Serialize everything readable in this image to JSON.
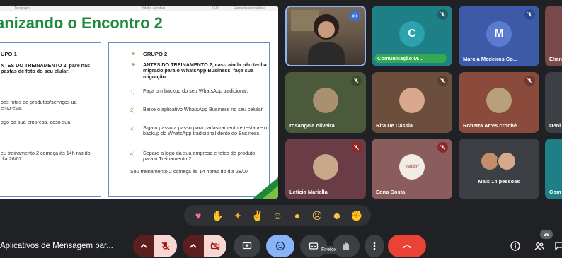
{
  "slide": {
    "top_strip": [
      "Telegraph",
      "Adobe Acrobat",
      "ISO",
      "Comunicacionalidad"
    ],
    "title": "anizando o Encontro 2",
    "group1": {
      "head": "UPO 1",
      "intro": "NTES DO TREINAMENTO 2, pare nas pastas de foto do seu elular:",
      "item1": "oas fotos de produtos/serviços ua empresa.",
      "item2": "ogo da sua empresa, caso sua.",
      "footer": "eu treinamento 2 começa às 14h ras do dia 28/07"
    },
    "group2": {
      "head": "GRUPO 2",
      "intro": "ANTES DO TREINAMENTO 2, caso ainda não tenha migrado para o WhatsApp Business, faça sua migração:",
      "items": [
        {
          "n": "1)",
          "text": "Faça um backup do seu WhatsApp tradicional."
        },
        {
          "n": "2)",
          "text": "Baixe o aplicativo WhatsApp Business no seu celular."
        },
        {
          "n": "3)",
          "text": "Siga o passo a passo para cadastramento e restaure o backup do WhatsApp tradicional dento do Business."
        },
        {
          "n": "4)",
          "text": "Separe a logo da sua empresa e fotos de produto para o Treinamento 2."
        }
      ],
      "footer": "Seu treinamento 2 começa às 14 horas do dia 28/07"
    }
  },
  "participants": [
    {
      "id": "speaker",
      "name": "",
      "color": "#3a6fb0"
    },
    {
      "id": "c",
      "name": "Comunicação M...",
      "initial": "C",
      "color": "#1e7f86",
      "pill": true
    },
    {
      "id": "m",
      "name": "Marcia Medeiros Co...",
      "initial": "M",
      "color": "#3d5aa8"
    },
    {
      "id": "elia",
      "name": "Elian",
      "color": "#7a4848"
    },
    {
      "id": "rosangela",
      "name": "rosangela oliveira",
      "color": "#4b5a3a"
    },
    {
      "id": "rita",
      "name": "Rita De Cássia",
      "color": "#6b4f3c"
    },
    {
      "id": "roberta",
      "name": "Roberta Artes crochê",
      "color": "#8a4a3c"
    },
    {
      "id": "deni",
      "name": "Deni",
      "color": "#3c3f44"
    },
    {
      "id": "leticia",
      "name": "Letícia Mariella",
      "color": "#6a3d46"
    },
    {
      "id": "edna",
      "name": "Edna Costa",
      "color": "#8a5c5c",
      "logo_text": "vallibri"
    },
    {
      "id": "mais",
      "name": "Mais 14 pessoas",
      "color": "#3c3f44"
    },
    {
      "id": "com",
      "name": "Com",
      "color": "#1e7f86"
    }
  ],
  "reactions": [
    "sparkling-heart",
    "thumbs-up",
    "party-popper",
    "clapping-hands",
    "tears-of-joy",
    "surprised-face",
    "crying-face",
    "thinking-face",
    "thumbs-down"
  ],
  "bottom": {
    "meeting_name": "Aplicativos de Mensagem par...",
    "tooltip": "Firefox",
    "participant_count": "26"
  },
  "colors": {
    "background": "#202124",
    "mute_red": "#ea4335",
    "control_red": "#ea4335",
    "accent_blue": "#8ab4f8",
    "slide_green": "#1d8a3a"
  }
}
